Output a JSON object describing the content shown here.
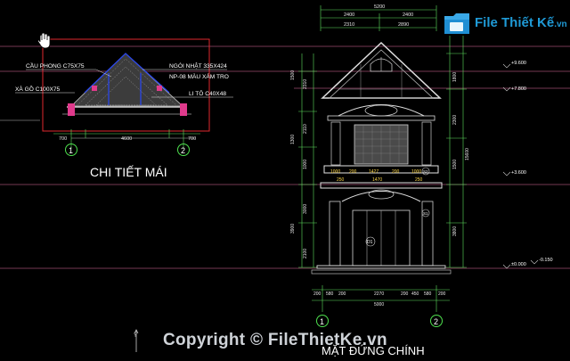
{
  "brand": {
    "name": "File Thiết Kế",
    "tld": ".vn"
  },
  "watermark": {
    "text": "Copyright © FileThietKe.vn"
  },
  "roof_detail": {
    "title": "CHI TIẾT MÁI",
    "labels": {
      "cau_phong": "CẦU PHONG C75X75",
      "xa_go": "XÀ GỒ C100X75",
      "ngoi": "NGÓI NHẬT 335X424",
      "np08": "NP-08 MÀU XÁM TRO",
      "li_to": "LI TÔ C40X48"
    },
    "dims": [
      "700",
      "4600",
      "700"
    ],
    "grid": [
      "1",
      "2"
    ]
  },
  "elevation": {
    "title": "MẶT ĐỨNG CHÍNH",
    "top_dims": {
      "total": "5200",
      "left": "2400",
      "right": "2400",
      "sub_left": "2310",
      "sub_right": "2890"
    },
    "bottom_dims": [
      "200",
      "580",
      "200",
      "2270",
      "200",
      "450",
      "580",
      "200"
    ],
    "bottom_total": "5000",
    "balcony_dims": [
      "1000",
      "200",
      "1427",
      "200",
      "1000"
    ],
    "balcony_dims2": [
      "250",
      "1470",
      "250"
    ],
    "levels": [
      "+9.600",
      "+7.800",
      "+3.600",
      "±0.000",
      "-0.150"
    ],
    "left_dims": [
      "1500",
      "2310",
      "2110",
      "1000",
      "1300",
      "3900",
      "1000",
      "3000",
      "900",
      "2100",
      "3000"
    ],
    "right_dims": [
      "1800",
      "2300",
      "1500",
      "2000",
      "3800",
      "300",
      "3000",
      "1800"
    ],
    "right_total": "15600",
    "tags": [
      "D1",
      "S1",
      "S2"
    ],
    "grid": [
      "1",
      "2"
    ]
  }
}
